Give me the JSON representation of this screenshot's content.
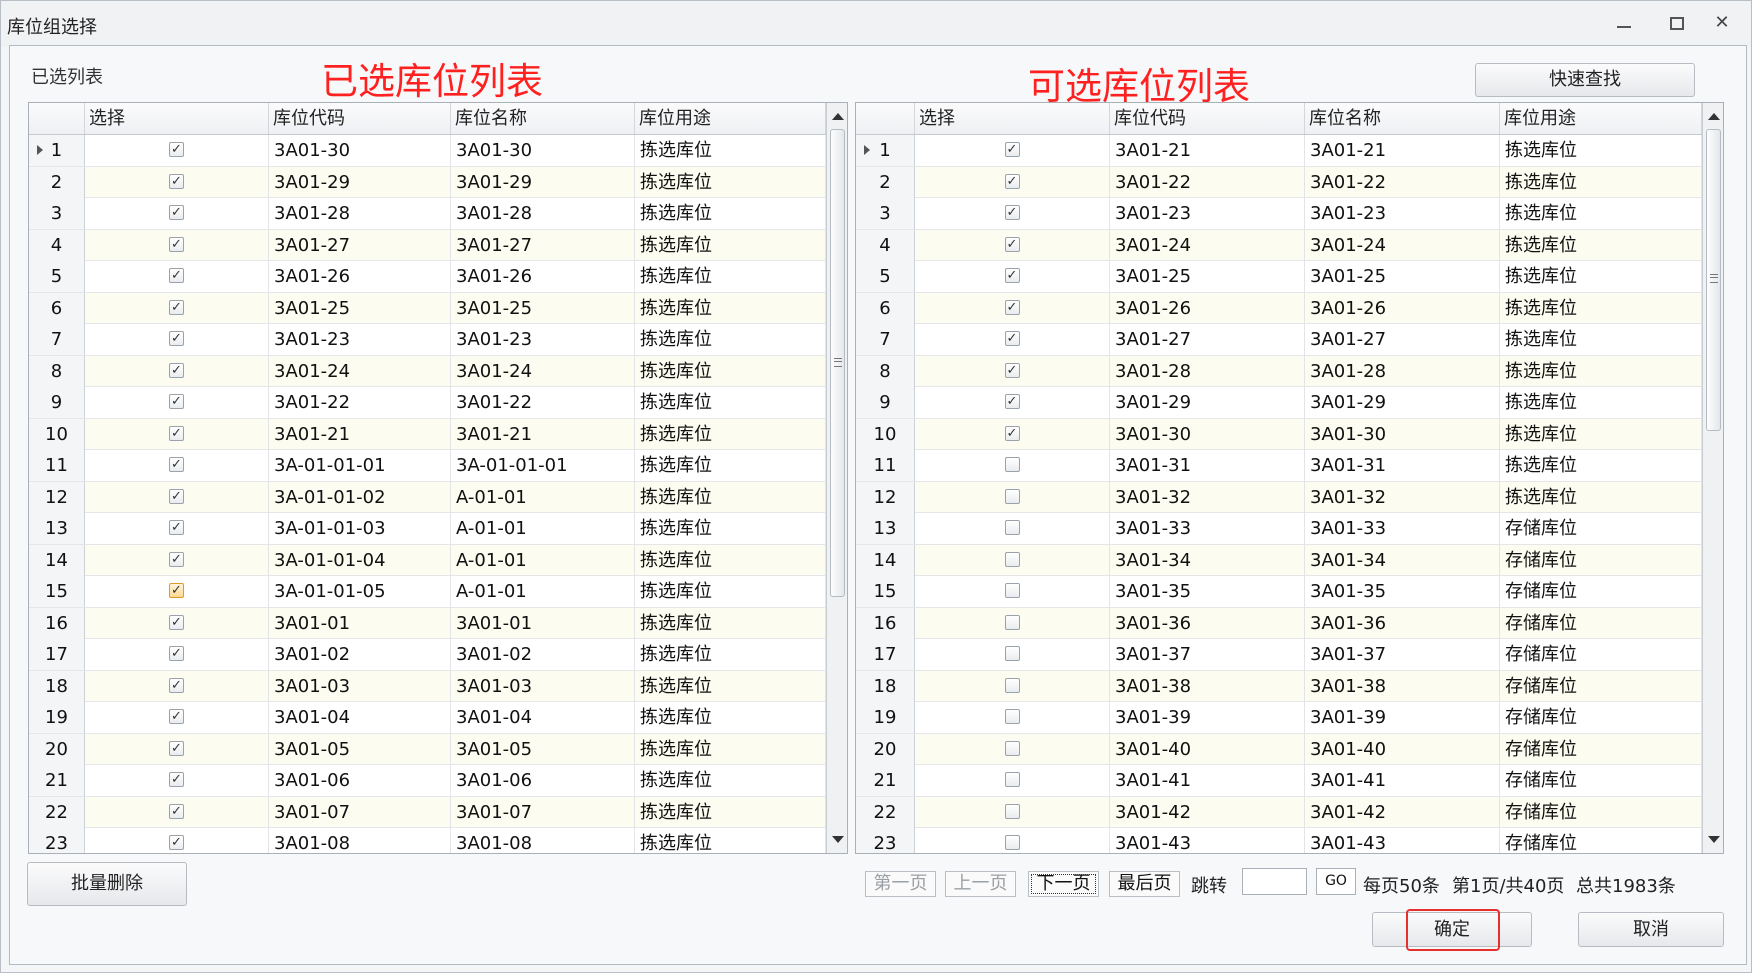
{
  "window": {
    "title": "库位组选择",
    "controls": [
      "minimize-icon",
      "restore-icon",
      "close-icon"
    ]
  },
  "left_panel": {
    "label": "已选列表",
    "annotation": "已选库位列表",
    "columns": [
      "选择",
      "库位代码",
      "库位名称",
      "库位用途"
    ],
    "rows": [
      {
        "n": "1",
        "checked": true,
        "code": "3A01-30",
        "name": "3A01-30",
        "use": "拣选库位"
      },
      {
        "n": "2",
        "checked": true,
        "code": "3A01-29",
        "name": "3A01-29",
        "use": "拣选库位"
      },
      {
        "n": "3",
        "checked": true,
        "code": "3A01-28",
        "name": "3A01-28",
        "use": "拣选库位"
      },
      {
        "n": "4",
        "checked": true,
        "code": "3A01-27",
        "name": "3A01-27",
        "use": "拣选库位"
      },
      {
        "n": "5",
        "checked": true,
        "code": "3A01-26",
        "name": "3A01-26",
        "use": "拣选库位"
      },
      {
        "n": "6",
        "checked": true,
        "code": "3A01-25",
        "name": "3A01-25",
        "use": "拣选库位"
      },
      {
        "n": "7",
        "checked": true,
        "code": "3A01-23",
        "name": "3A01-23",
        "use": "拣选库位"
      },
      {
        "n": "8",
        "checked": true,
        "code": "3A01-24",
        "name": "3A01-24",
        "use": "拣选库位"
      },
      {
        "n": "9",
        "checked": true,
        "code": "3A01-22",
        "name": "3A01-22",
        "use": "拣选库位"
      },
      {
        "n": "10",
        "checked": true,
        "code": "3A01-21",
        "name": "3A01-21",
        "use": "拣选库位"
      },
      {
        "n": "11",
        "checked": true,
        "code": "3A-01-01-01",
        "name": "3A-01-01-01",
        "use": "拣选库位"
      },
      {
        "n": "12",
        "checked": true,
        "code": "3A-01-01-02",
        "name": "A-01-01",
        "use": "拣选库位"
      },
      {
        "n": "13",
        "checked": true,
        "code": "3A-01-01-03",
        "name": "A-01-01",
        "use": "拣选库位"
      },
      {
        "n": "14",
        "checked": true,
        "code": "3A-01-01-04",
        "name": "A-01-01",
        "use": "拣选库位"
      },
      {
        "n": "15",
        "checked": true,
        "code": "3A-01-01-05",
        "name": "A-01-01",
        "use": "拣选库位",
        "hover": true
      },
      {
        "n": "16",
        "checked": true,
        "code": "3A01-01",
        "name": "3A01-01",
        "use": "拣选库位"
      },
      {
        "n": "17",
        "checked": true,
        "code": "3A01-02",
        "name": "3A01-02",
        "use": "拣选库位"
      },
      {
        "n": "18",
        "checked": true,
        "code": "3A01-03",
        "name": "3A01-03",
        "use": "拣选库位"
      },
      {
        "n": "19",
        "checked": true,
        "code": "3A01-04",
        "name": "3A01-04",
        "use": "拣选库位"
      },
      {
        "n": "20",
        "checked": true,
        "code": "3A01-05",
        "name": "3A01-05",
        "use": "拣选库位"
      },
      {
        "n": "21",
        "checked": true,
        "code": "3A01-06",
        "name": "3A01-06",
        "use": "拣选库位"
      },
      {
        "n": "22",
        "checked": true,
        "code": "3A01-07",
        "name": "3A01-07",
        "use": "拣选库位"
      },
      {
        "n": "23",
        "checked": true,
        "code": "3A01-08",
        "name": "3A01-08",
        "use": "拣选库位"
      }
    ],
    "batch_delete_label": "批量删除"
  },
  "right_panel": {
    "annotation": "可选库位列表",
    "quick_find_label": "快速查找",
    "columns": [
      "选择",
      "库位代码",
      "库位名称",
      "库位用途"
    ],
    "rows": [
      {
        "n": "1",
        "checked": true,
        "code": "3A01-21",
        "name": "3A01-21",
        "use": "拣选库位"
      },
      {
        "n": "2",
        "checked": true,
        "code": "3A01-22",
        "name": "3A01-22",
        "use": "拣选库位"
      },
      {
        "n": "3",
        "checked": true,
        "code": "3A01-23",
        "name": "3A01-23",
        "use": "拣选库位"
      },
      {
        "n": "4",
        "checked": true,
        "code": "3A01-24",
        "name": "3A01-24",
        "use": "拣选库位"
      },
      {
        "n": "5",
        "checked": true,
        "code": "3A01-25",
        "name": "3A01-25",
        "use": "拣选库位"
      },
      {
        "n": "6",
        "checked": true,
        "code": "3A01-26",
        "name": "3A01-26",
        "use": "拣选库位"
      },
      {
        "n": "7",
        "checked": true,
        "code": "3A01-27",
        "name": "3A01-27",
        "use": "拣选库位"
      },
      {
        "n": "8",
        "checked": true,
        "code": "3A01-28",
        "name": "3A01-28",
        "use": "拣选库位"
      },
      {
        "n": "9",
        "checked": true,
        "code": "3A01-29",
        "name": "3A01-29",
        "use": "拣选库位"
      },
      {
        "n": "10",
        "checked": true,
        "code": "3A01-30",
        "name": "3A01-30",
        "use": "拣选库位"
      },
      {
        "n": "11",
        "checked": false,
        "code": "3A01-31",
        "name": "3A01-31",
        "use": "拣选库位"
      },
      {
        "n": "12",
        "checked": false,
        "code": "3A01-32",
        "name": "3A01-32",
        "use": "拣选库位"
      },
      {
        "n": "13",
        "checked": false,
        "code": "3A01-33",
        "name": "3A01-33",
        "use": "存储库位"
      },
      {
        "n": "14",
        "checked": false,
        "code": "3A01-34",
        "name": "3A01-34",
        "use": "存储库位"
      },
      {
        "n": "15",
        "checked": false,
        "code": "3A01-35",
        "name": "3A01-35",
        "use": "存储库位"
      },
      {
        "n": "16",
        "checked": false,
        "code": "3A01-36",
        "name": "3A01-36",
        "use": "存储库位"
      },
      {
        "n": "17",
        "checked": false,
        "code": "3A01-37",
        "name": "3A01-37",
        "use": "存储库位"
      },
      {
        "n": "18",
        "checked": false,
        "code": "3A01-38",
        "name": "3A01-38",
        "use": "存储库位"
      },
      {
        "n": "19",
        "checked": false,
        "code": "3A01-39",
        "name": "3A01-39",
        "use": "存储库位"
      },
      {
        "n": "20",
        "checked": false,
        "code": "3A01-40",
        "name": "3A01-40",
        "use": "存储库位"
      },
      {
        "n": "21",
        "checked": false,
        "code": "3A01-41",
        "name": "3A01-41",
        "use": "存储库位"
      },
      {
        "n": "22",
        "checked": false,
        "code": "3A01-42",
        "name": "3A01-42",
        "use": "存储库位"
      },
      {
        "n": "23",
        "checked": false,
        "code": "3A01-43",
        "name": "3A01-43",
        "use": "存储库位"
      }
    ]
  },
  "pager": {
    "first": "第一页",
    "prev": "上一页",
    "next": "下一页",
    "last": "最后页",
    "jump_label": "跳转",
    "go": "GO",
    "per_page": "每页50条",
    "page_info": "第1页/共40页",
    "total": "总共1983条"
  },
  "footer": {
    "confirm": "确定",
    "cancel": "取消"
  },
  "colors": {
    "annotation": "#ff2020",
    "highlight_box": "#e6302e",
    "row_alt": "#fdfcf0"
  }
}
